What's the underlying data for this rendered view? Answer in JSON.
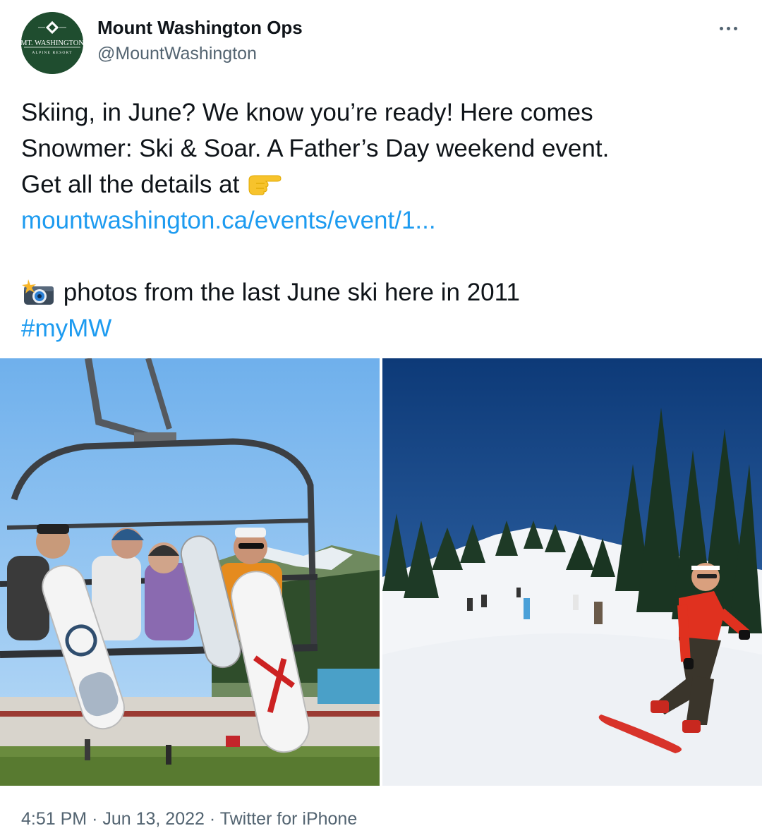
{
  "author": {
    "name": "Mount Washington Ops",
    "handle": "@MountWashington",
    "avatar_logo": {
      "line1": "MT. WASHINGTON",
      "line2": "ALPINE RESORT"
    }
  },
  "tweet": {
    "lines": [
      "Skiing, in June? We know you’re ready! Here comes",
      "Snowmer: Ski & Soar. A Father’s Day weekend event.",
      "Get all the details at"
    ],
    "link": "mountwashington.ca/events/event/1...",
    "photos_caption": "photos from the last June ski here in 2011",
    "hashtag": "#myMW",
    "emojis": [
      "pointing-right-emoji",
      "camera-flash-emoji"
    ]
  },
  "media": {
    "photos": [
      "chairlift-photo",
      "snowboarder-photo"
    ]
  },
  "footer": {
    "time": "4:51 PM",
    "separator": "·",
    "date": "Jun 13, 2022",
    "source": "Twitter for iPhone"
  },
  "colors": {
    "link": "#1d9bf0",
    "secondary_text": "#536471",
    "primary_text": "#0f1419",
    "avatar_bg": "#1f4d2f"
  }
}
